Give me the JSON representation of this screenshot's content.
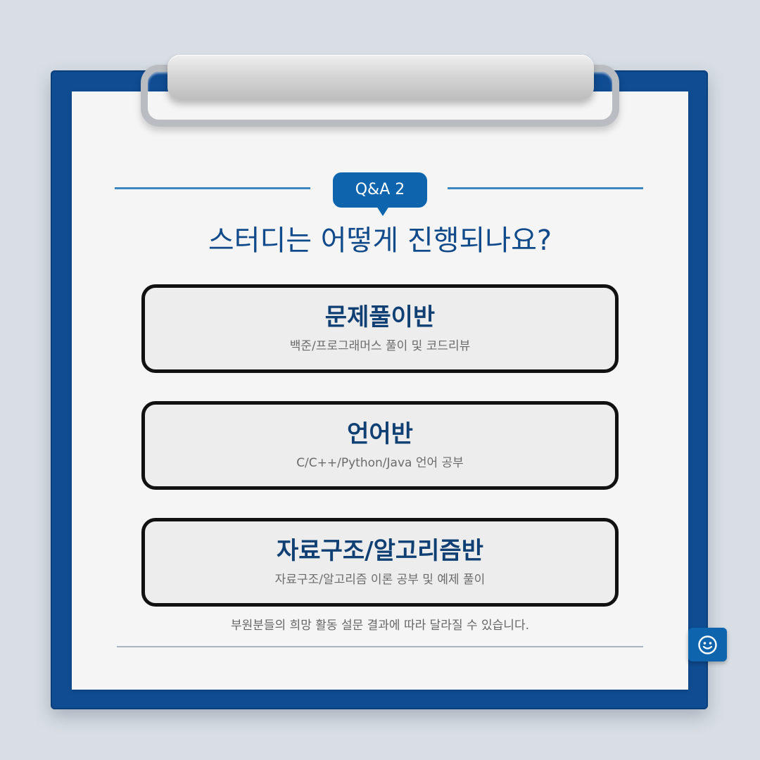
{
  "badge": {
    "label": "Q&A 2"
  },
  "question": "스터디는 어떻게 진행되나요?",
  "cards": [
    {
      "title": "문제풀이반",
      "subtitle": "백준/프로그래머스 풀이 및 코드리뷰"
    },
    {
      "title": "언어반",
      "subtitle": "C/C++/Python/Java 언어 공부"
    },
    {
      "title": "자료구조/알고리즘반",
      "subtitle": "자료구조/알고리즘 이론 공부 및 예제 풀이"
    }
  ],
  "footnote": "부원분들의 희망 활동 설문 결과에 따라 달라질 수 있습니다.",
  "icons": {
    "corner_button": "smiley-icon"
  },
  "colors": {
    "board": "#0f4c92",
    "accent": "#0e64ad",
    "heading": "#104a8a",
    "card_title": "#0f3f73"
  }
}
